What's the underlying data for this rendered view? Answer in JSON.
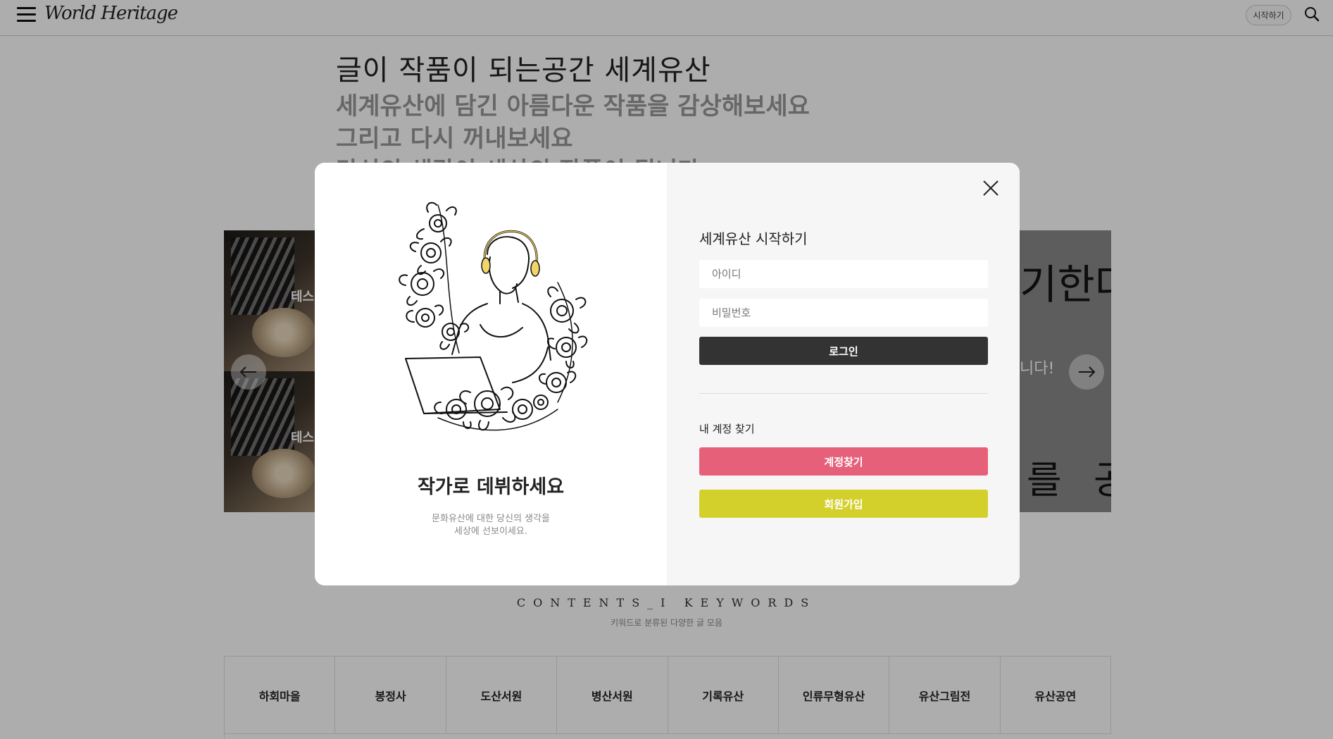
{
  "header": {
    "logo": "World Heritage",
    "start_label": "시작하기"
  },
  "hero": {
    "line1": "글이 작품이 되는공간 세계유산",
    "line2": "세계유산에 담긴 아름다운 작품을 감상해보세요",
    "line3": "그리고 다시 꺼내보세요",
    "line4": "당신의 생각이 세상의 작품이 됩니다"
  },
  "slider": {
    "left_caption_1": "테스",
    "left_caption_2": "테스",
    "right_text_1": "기한다",
    "right_text_2": "니다!",
    "right_text_3": "를 공"
  },
  "keywords": {
    "title": "CONTENTS_I KEYWORDS",
    "subtitle": "키워드로 분류된 다양한 글 모음",
    "items": [
      "하회마을",
      "봉정사",
      "도산서원",
      "병산서원",
      "기록유산",
      "인류무형유산",
      "유산그림전",
      "유산공연"
    ]
  },
  "modal": {
    "promo": {
      "title": "작가로 데뷔하세요",
      "desc_line1": "문화유산에 대한 당신의 생각을",
      "desc_line2": "세상에 선보이세요."
    },
    "form": {
      "title": "세계유산 시작하기",
      "id_placeholder": "아이디",
      "pw_placeholder": "비밀번호",
      "login_label": "로그인",
      "find_label": "내 계정 찾기",
      "find_button": "계정찾기",
      "join_button": "회원가입"
    }
  },
  "colors": {
    "login": "#333333",
    "find": "#e7607a",
    "join": "#d3d02c"
  },
  "icons": {
    "menu": "hamburger-icon",
    "search": "search-icon",
    "close": "close-icon",
    "prev": "arrow-left-icon",
    "next": "arrow-right-icon"
  }
}
